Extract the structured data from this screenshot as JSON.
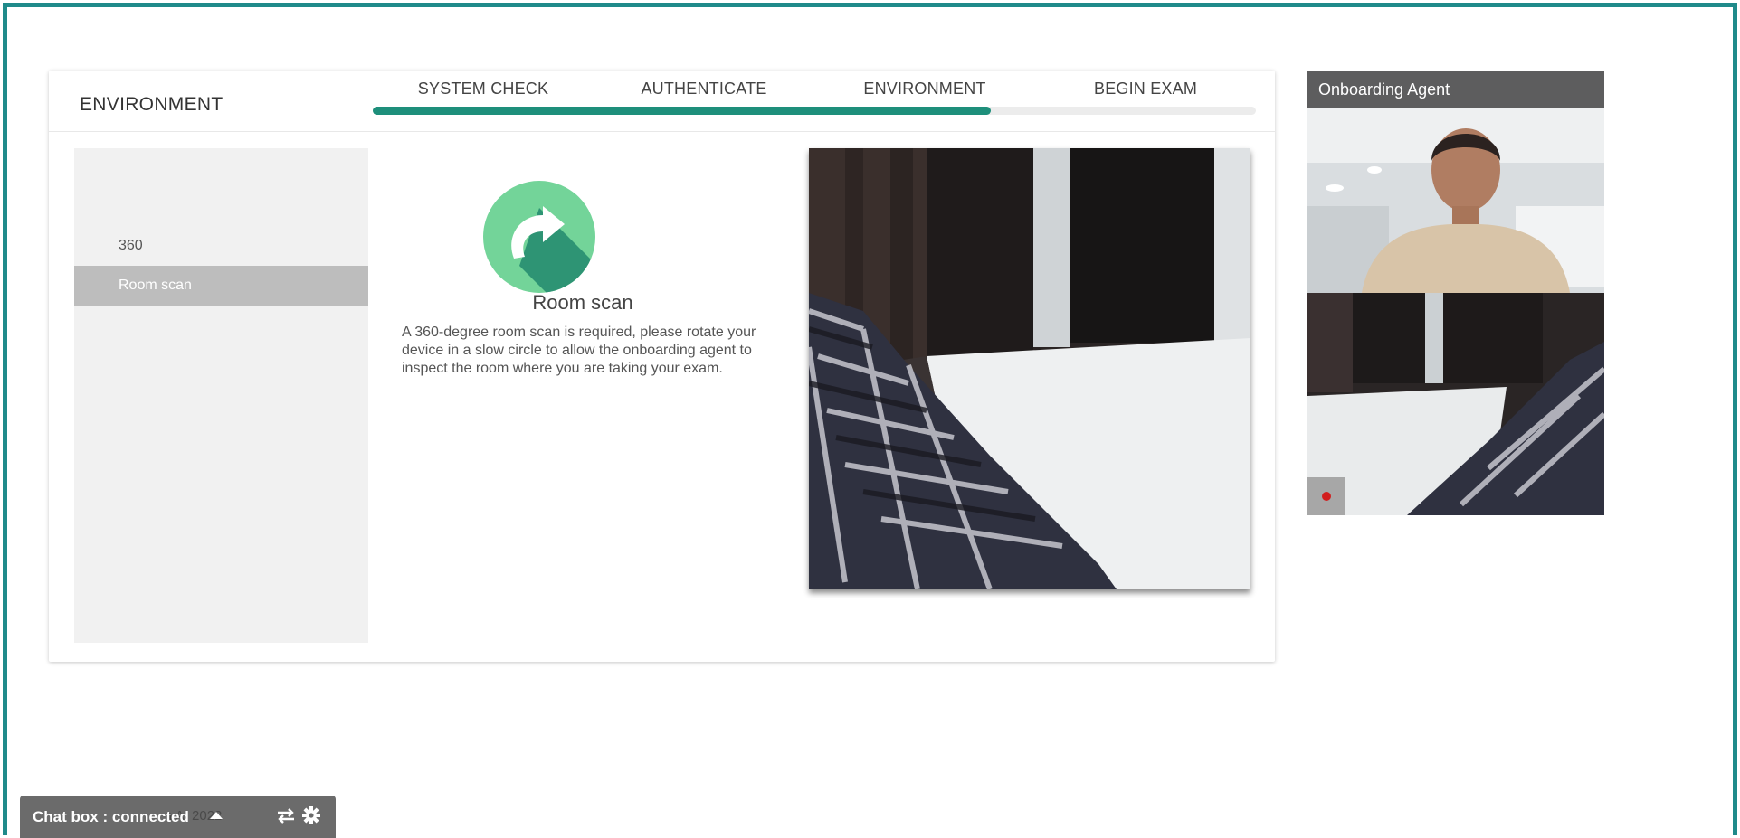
{
  "page": {
    "title": "ENVIRONMENT"
  },
  "steps": [
    {
      "label": "SYSTEM CHECK"
    },
    {
      "label": "AUTHENTICATE"
    },
    {
      "label": "ENVIRONMENT"
    },
    {
      "label": "BEGIN EXAM"
    }
  ],
  "progress": {
    "fraction": 0.7,
    "color": "#1e8f7b"
  },
  "sidebar": {
    "items": [
      {
        "label": "360",
        "active": false
      },
      {
        "label": "Room scan",
        "active": true
      }
    ]
  },
  "instruction": {
    "icon": "rotate-arrow-icon",
    "title": "Room scan",
    "body": "A 360-degree room scan is required, please rotate your device in a slow circle to allow the onboarding agent to inspect the room where you are taking your exam."
  },
  "agent_panel": {
    "label": "Onboarding Agent",
    "record_icon": "record-dot-icon"
  },
  "chat_box": {
    "status": "Chat box : connected",
    "ghost_text": "n AI 2022",
    "icons": [
      "chevron-up-icon",
      "swap-icon",
      "gear-icon"
    ]
  },
  "colors": {
    "frame_border": "#1f8a8a",
    "accent": "#1e8f7b",
    "icon_circle": "#73d499"
  }
}
